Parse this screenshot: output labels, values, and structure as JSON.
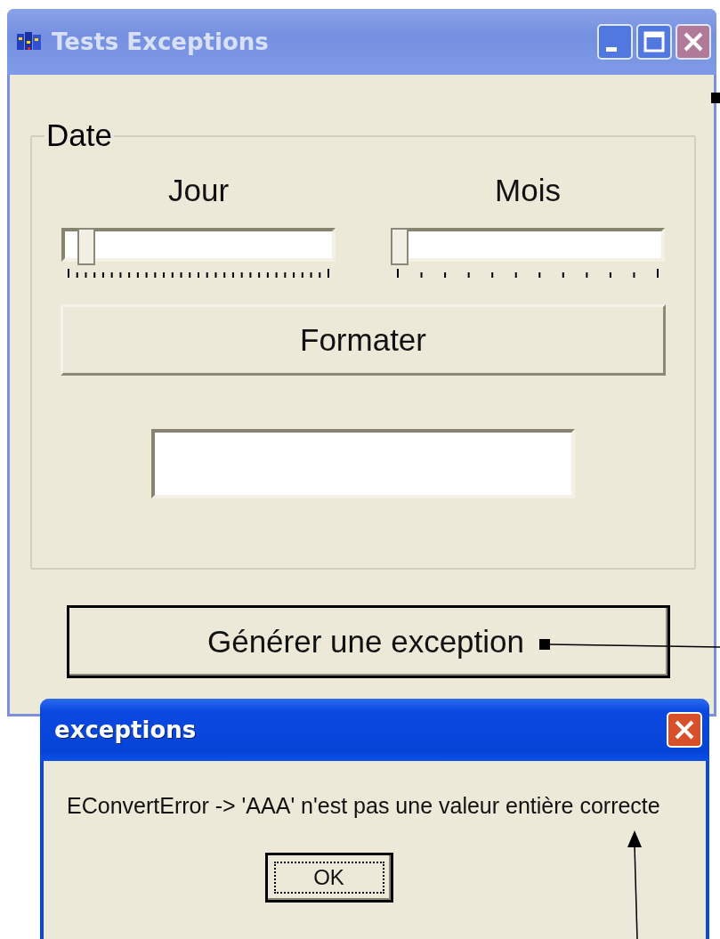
{
  "main_window": {
    "title": "Tests Exceptions",
    "active": false
  },
  "group": {
    "title": "Date"
  },
  "sliders": [
    {
      "label": "Jour",
      "level": 0.06
    },
    {
      "label": "Mois",
      "level": 0
    }
  ],
  "format_button": {
    "label": "Formater"
  },
  "generate_button": {
    "label": "Générer une exception"
  },
  "dialog": {
    "title": "exceptions",
    "active": true,
    "message": "EConvertError -> 'AAA' n'est pas une valeur entière correcte",
    "ok_button": {
      "label": "OK",
      "focused": true
    }
  }
}
